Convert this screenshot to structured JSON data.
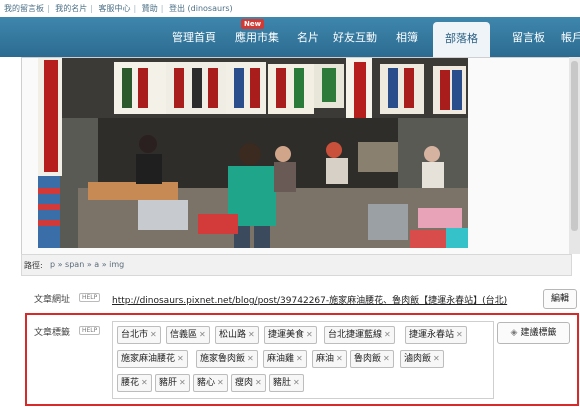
{
  "top_links": [
    "我的留言板",
    "我的名片",
    "客服中心",
    "贊助",
    "登出 (dinosaurs)"
  ],
  "nav": {
    "items": [
      "管理首頁",
      "應用市集",
      "名片",
      "好友互動",
      "相簿",
      "部落格",
      "留言板",
      "帳戶"
    ],
    "badge": "New",
    "active": "部落格"
  },
  "image": {
    "signs": [
      "蚵仔煎",
      "排骨保證",
      "豬肚湯 20元",
      "豬心湯 20元",
      "豬心湯 20元",
      "麻油豬心",
      "麻油腰花",
      "國林精肉",
      "祥記",
      "魯肉飯"
    ]
  },
  "pathbar": {
    "label": "路徑:",
    "crumbs": "p » span » a » img"
  },
  "article_url": {
    "label": "文章網址",
    "help": "HELP",
    "value": "http://dinosaurs.pixnet.net/blog/post/39742267-施家麻油腰花、魯肉飯【捷運永春站】(台北)",
    "edit_button": "編輯"
  },
  "article_tags": {
    "label": "文章標籤",
    "help": "HELP",
    "suggest_button": "建議標籤",
    "tags": [
      "台北市",
      "信義區",
      "松山路",
      "捷運美食",
      "台北捷運藍線",
      "捷運永春站",
      "施家麻油腰花",
      "施家魯肉飯",
      "麻油雞",
      "麻油",
      "魯肉飯",
      "滷肉飯",
      "腰花",
      "豬肝",
      "豬心",
      "瘦肉",
      "豬肚"
    ]
  },
  "colors": {
    "nav_bg": "#3479a0",
    "highlight_border": "#d72b2b",
    "link": "#4b6f86"
  }
}
